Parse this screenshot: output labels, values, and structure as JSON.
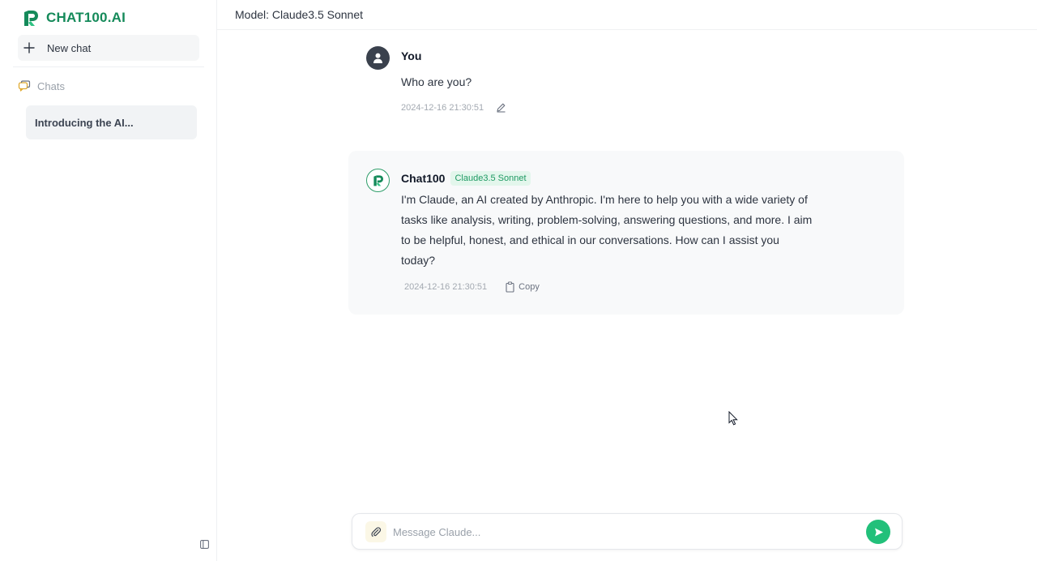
{
  "brand": {
    "name": "CHAT100.AI",
    "accent": "#158a5a"
  },
  "sidebar": {
    "new_chat_label": "New chat",
    "chats_label": "Chats",
    "conversations": [
      {
        "title": "Introducing the AI..."
      }
    ]
  },
  "header": {
    "title": "Model: Claude3.5 Sonnet"
  },
  "messages": [
    {
      "role": "user",
      "author": "You",
      "text": "Who are you?",
      "timestamp": "2024-12-16 21:30:51",
      "icons": [
        "avatar-user-icon",
        "edit-icon"
      ]
    },
    {
      "role": "assistant",
      "author": "Chat100",
      "model_badge": "Claude3.5 Sonnet",
      "text": "I'm Claude, an AI created by Anthropic. I'm here to help you with a wide variety of tasks like analysis, writing, problem-solving, answering questions, and more. I aim to be helpful, honest, and ethical in our conversations. How can I assist you today?",
      "timestamp": "2024-12-16 21:30:51",
      "copy_label": "Copy",
      "icons": [
        "chat100-logo-icon",
        "copy-icon"
      ]
    }
  ],
  "composer": {
    "placeholder": "Message Claude...",
    "value": "",
    "send_color": "#22c07a",
    "icons": [
      "paperclip-icon",
      "send-icon"
    ]
  }
}
